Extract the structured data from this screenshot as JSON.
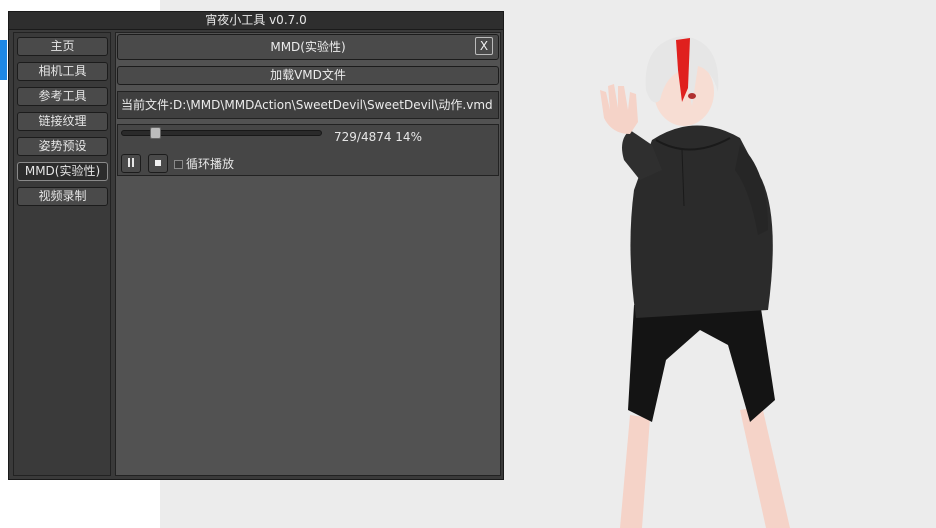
{
  "window": {
    "title": "宵夜小工具 v0.7.0"
  },
  "sidebar": {
    "items": [
      {
        "label": "主页"
      },
      {
        "label": "相机工具"
      },
      {
        "label": "参考工具"
      },
      {
        "label": "链接纹理"
      },
      {
        "label": "姿势预设"
      },
      {
        "label": "MMD(实验性)",
        "active": true
      },
      {
        "label": "视频录制"
      }
    ]
  },
  "panel": {
    "title": "MMD(实验性)",
    "close_label": "X",
    "load_button": "加载VMD文件",
    "current_file": "当前文件:D:\\MMD\\MMDAction\\SweetDevil\\SweetDevil\\动作.vmd"
  },
  "player": {
    "progress_text": "729/4874 14%",
    "current_frame": 729,
    "total_frames": 4874,
    "pause_icon": "pause-icon",
    "stop_icon": "stop-icon",
    "loop_label": "循环播放",
    "loop_checked": false
  },
  "colors": {
    "accent": "#1e88e5",
    "panel_bg": "#525252",
    "sidebar_bg": "#3a3a3a",
    "hair_streak": "#e0201e"
  }
}
